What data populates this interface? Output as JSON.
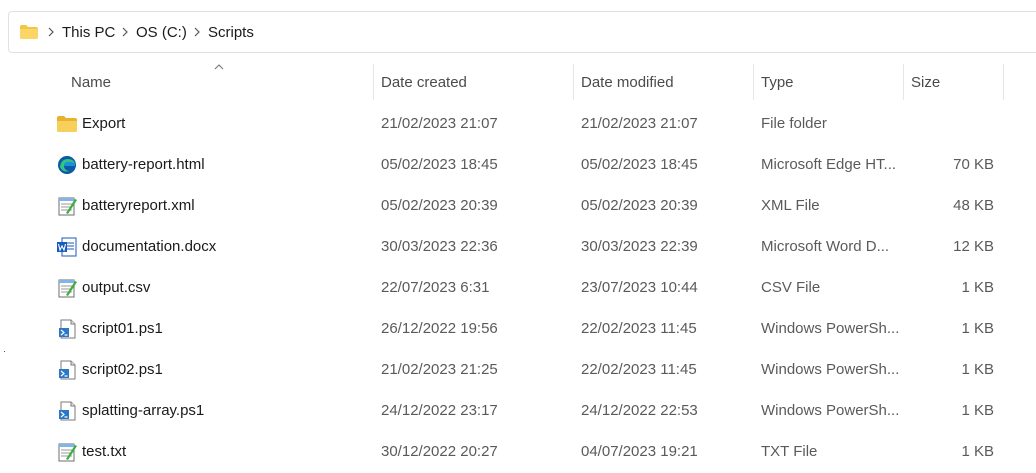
{
  "breadcrumb": [
    "This PC",
    "OS (C:)",
    "Scripts"
  ],
  "columns": {
    "name": "Name",
    "created": "Date created",
    "modified": "Date modified",
    "type": "Type",
    "size": "Size"
  },
  "files": [
    {
      "name": "Export",
      "created": "21/02/2023 21:07",
      "modified": "21/02/2023 21:07",
      "type": "File folder",
      "size": "",
      "icon": "folder-icon"
    },
    {
      "name": "battery-report.html",
      "created": "05/02/2023 18:45",
      "modified": "05/02/2023 18:45",
      "type": "Microsoft Edge HT...",
      "size": "70 KB",
      "icon": "edge-icon"
    },
    {
      "name": "batteryreport.xml",
      "created": "05/02/2023 20:39",
      "modified": "05/02/2023 20:39",
      "type": "XML File",
      "size": "48 KB",
      "icon": "notepad-icon"
    },
    {
      "name": "documentation.docx",
      "created": "30/03/2023 22:36",
      "modified": "30/03/2023 22:39",
      "type": "Microsoft Word D...",
      "size": "12 KB",
      "icon": "word-icon"
    },
    {
      "name": "output.csv",
      "created": "22/07/2023 6:31",
      "modified": "23/07/2023 10:44",
      "type": "CSV File",
      "size": "1 KB",
      "icon": "notepad-icon"
    },
    {
      "name": "script01.ps1",
      "created": "26/12/2022 19:56",
      "modified": "22/02/2023 11:45",
      "type": "Windows PowerSh...",
      "size": "1 KB",
      "icon": "powershell-icon"
    },
    {
      "name": "script02.ps1",
      "created": "21/02/2023 21:25",
      "modified": "22/02/2023 11:45",
      "type": "Windows PowerSh...",
      "size": "1 KB",
      "icon": "powershell-icon"
    },
    {
      "name": "splatting-array.ps1",
      "created": "24/12/2022 23:17",
      "modified": "24/12/2022 22:53",
      "type": "Windows PowerSh...",
      "size": "1 KB",
      "icon": "powershell-icon"
    },
    {
      "name": "test.txt",
      "created": "30/12/2022 20:27",
      "modified": "04/07/2023 19:21",
      "type": "TXT File",
      "size": "1 KB",
      "icon": "notepad-icon"
    }
  ],
  "colors": {
    "folder": "#f4c542",
    "edge_blue": "#0c59a4",
    "edge_teal": "#33c481",
    "word_blue": "#185abd",
    "ps_blue": "#2b78c8"
  }
}
